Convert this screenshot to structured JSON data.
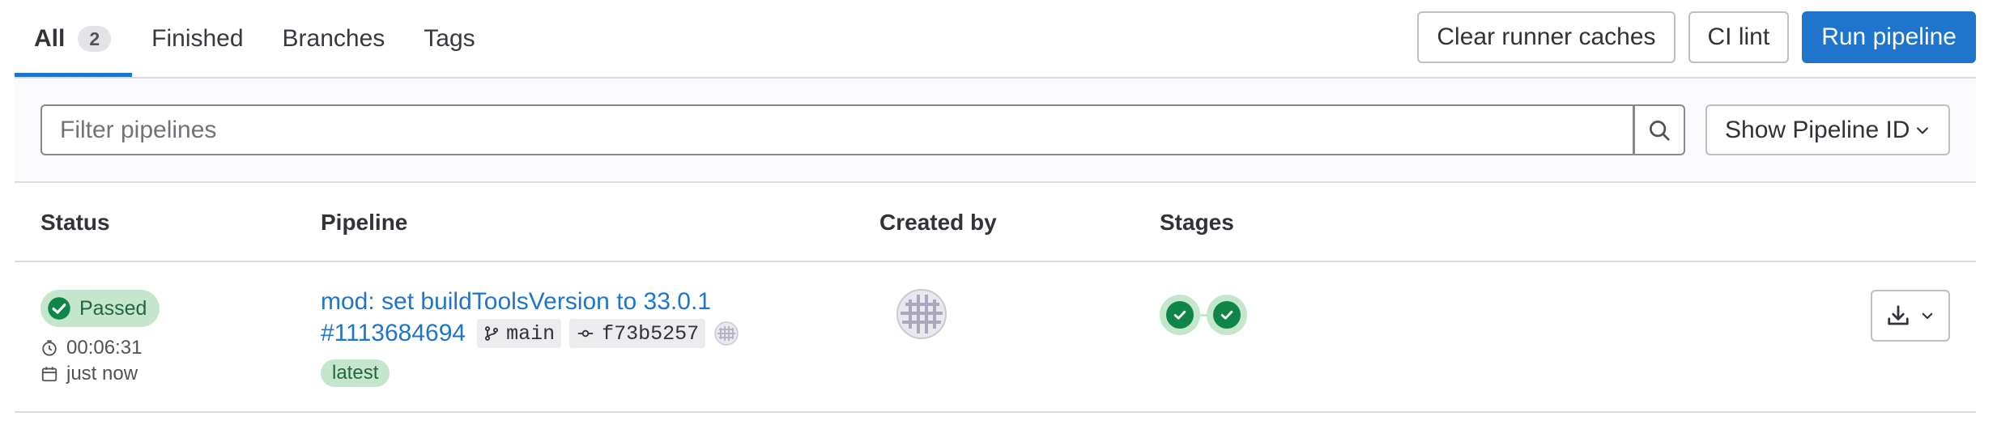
{
  "tabs": [
    {
      "label": "All",
      "count": "2",
      "active": true
    },
    {
      "label": "Finished"
    },
    {
      "label": "Branches"
    },
    {
      "label": "Tags"
    }
  ],
  "actions": {
    "clear_caches": "Clear runner caches",
    "ci_lint": "CI lint",
    "run_pipeline": "Run pipeline"
  },
  "filter": {
    "placeholder": "Filter pipelines",
    "value": "",
    "show_id_label": "Show Pipeline ID"
  },
  "table": {
    "headers": {
      "status": "Status",
      "pipeline": "Pipeline",
      "created_by": "Created by",
      "stages": "Stages"
    },
    "rows": [
      {
        "status": "Passed",
        "duration": "00:06:31",
        "finished": "just now",
        "title": "mod: set buildToolsVersion to 33.0.1",
        "pipeline_id": "#1113684694",
        "branch": "main",
        "commit": "f73b5257",
        "badge": "latest",
        "stages": [
          "passed",
          "passed"
        ]
      }
    ]
  },
  "colors": {
    "accent": "#1f75cb",
    "success": "#108548",
    "success_bg": "#c3e6cd"
  },
  "icons": {
    "search": "search-icon",
    "chevron": "chevron-down-icon",
    "clock": "clock-icon",
    "calendar": "calendar-icon",
    "branch": "branch-icon",
    "commit": "commit-icon",
    "download": "download-icon",
    "check": "status-success-icon"
  }
}
